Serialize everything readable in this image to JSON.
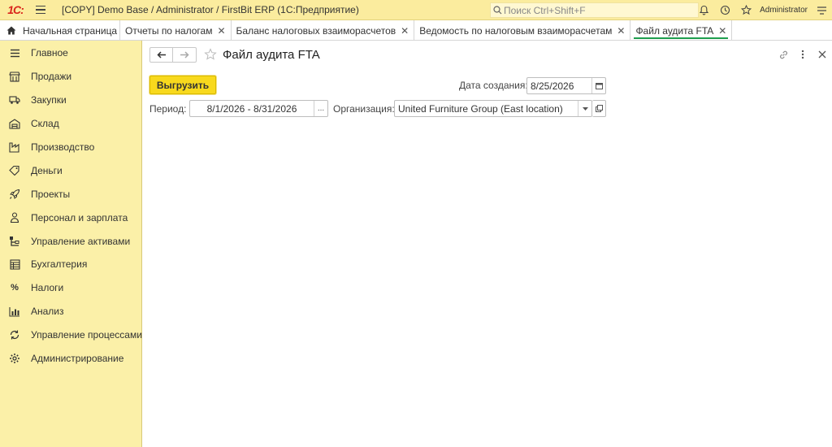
{
  "topbar": {
    "logo": "1С:",
    "title": "[COPY] Demo Base / Administrator / FirstBit ERP  (1С:Предприятие)",
    "search_placeholder": "Поиск Ctrl+Shift+F",
    "user": "Administrator"
  },
  "tabs": [
    {
      "label": "Начальная страница"
    },
    {
      "label": "Отчеты по налогам"
    },
    {
      "label": "Баланс налоговых взаиморасчетов"
    },
    {
      "label": "Ведомость по налоговым взаиморасчетам"
    },
    {
      "label": "Файл аудита FTA"
    }
  ],
  "sidebar": {
    "items": [
      {
        "label": "Главное",
        "icon": "menu-icon"
      },
      {
        "label": "Продажи",
        "icon": "shop-icon"
      },
      {
        "label": "Закупки",
        "icon": "truck-icon"
      },
      {
        "label": "Склад",
        "icon": "warehouse-icon"
      },
      {
        "label": "Производство",
        "icon": "factory-icon"
      },
      {
        "label": "Деньги",
        "icon": "money-icon"
      },
      {
        "label": "Проекты",
        "icon": "rocket-icon"
      },
      {
        "label": "Персонал и зарплата",
        "icon": "person-icon"
      },
      {
        "label": "Управление активами",
        "icon": "assets-icon"
      },
      {
        "label": "Бухгалтерия",
        "icon": "ledger-icon"
      },
      {
        "label": "Налоги",
        "icon": "percent-icon"
      },
      {
        "label": "Анализ",
        "icon": "chart-icon"
      },
      {
        "label": "Управление процессами",
        "icon": "process-icon"
      },
      {
        "label": "Администрирование",
        "icon": "gear-icon"
      }
    ]
  },
  "form": {
    "title": "Файл аудита FTA",
    "export_button": "Выгрузить",
    "created_label": "Дата создания:",
    "created_value": "8/25/2026",
    "period_label": "Период:",
    "period_value": "8/1/2026 - 8/31/2026",
    "period_button": "...",
    "org_label": "Организация:",
    "org_value": "United Furniture Group (East location)"
  },
  "colors": {
    "topbar_bg": "#fbec9e",
    "sidebar_bg": "#fbf0a8",
    "button_yellow": "#f8d91d",
    "active_tab_underline": "#1e9e4e",
    "logo_red": "#d9251c"
  }
}
